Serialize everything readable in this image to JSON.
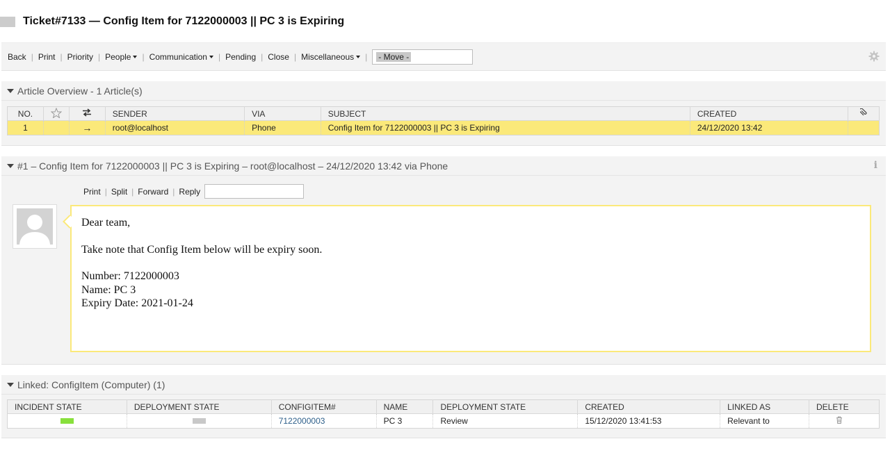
{
  "ticket": {
    "title": "Ticket#7133 — Config Item for 7122000003 || PC 3 is Expiring"
  },
  "toolbar": {
    "items": [
      {
        "label": "Back",
        "dropdown": false
      },
      {
        "label": "Print",
        "dropdown": false
      },
      {
        "label": "Priority",
        "dropdown": false
      },
      {
        "label": "People",
        "dropdown": true
      },
      {
        "label": "Communication",
        "dropdown": true
      },
      {
        "label": "Pending",
        "dropdown": false
      },
      {
        "label": "Close",
        "dropdown": false
      },
      {
        "label": "Miscellaneous",
        "dropdown": true
      }
    ],
    "move_select": "- Move -",
    "settings_icon": "gear-icon"
  },
  "article_overview": {
    "header": "Article Overview - 1 Article(s)",
    "columns": [
      "NO.",
      "",
      "",
      "SENDER",
      "VIA",
      "SUBJECT",
      "CREATED",
      ""
    ],
    "rows": [
      {
        "no": "1",
        "direction": "→",
        "sender": "root@localhost",
        "via": "Phone",
        "subject": "Config Item for 7122000003 || PC 3 is Expiring",
        "created": "24/12/2020 13:42"
      }
    ]
  },
  "article": {
    "header": "#1 – Config Item for 7122000003 || PC 3 is Expiring – root@localhost – 24/12/2020 13:42 via Phone",
    "actions": [
      "Print",
      "Split",
      "Forward",
      "Reply"
    ],
    "body": {
      "greeting": "Dear team,",
      "intro": "Take note that Config Item below will be expiry soon.",
      "number": "Number: 7122000003",
      "name": "Name: PC 3",
      "expiry": "Expiry Date: 2021-01-24"
    },
    "info_icon": "i"
  },
  "linked": {
    "header": "Linked: ConfigItem (Computer) (1)",
    "columns": [
      "INCIDENT STATE",
      "DEPLOYMENT STATE",
      "CONFIGITEM#",
      "NAME",
      "DEPLOYMENT STATE",
      "CREATED",
      "LINKED AS",
      "DELETE"
    ],
    "rows": [
      {
        "incident_color": "#88e03c",
        "deployment_color": "#c8c8c8",
        "configitem": "7122000003",
        "name": "PC 3",
        "deployment_state": "Review",
        "created": "15/12/2020 13:41:53",
        "linked_as": "Relevant to"
      }
    ]
  },
  "colors": {
    "highlight": "#fbe97a",
    "widget_bg": "#f3f3f3",
    "link": "#2d5f8a"
  }
}
